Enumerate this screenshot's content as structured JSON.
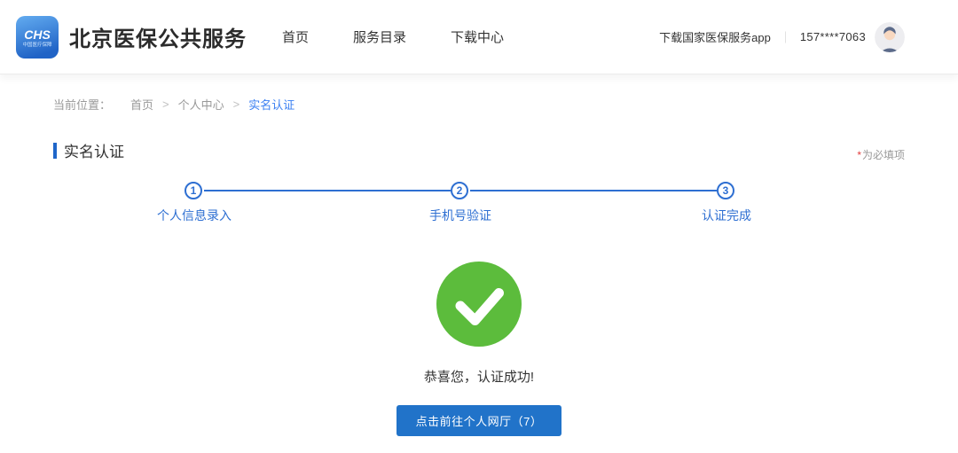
{
  "header": {
    "logo": {
      "abbr": "CHS",
      "subtext": "中国医疗保障"
    },
    "title": "北京医保公共服务",
    "nav": [
      {
        "label": "首页"
      },
      {
        "label": "服务目录"
      },
      {
        "label": "下载中心"
      }
    ],
    "download_app": "下载国家医保服务app",
    "divider": "｜",
    "phone": "157****7063"
  },
  "breadcrumb": {
    "prefix": "当前位置：",
    "items": [
      "首页",
      "个人中心",
      "实名认证"
    ],
    "separator": ">"
  },
  "page": {
    "title": "实名认证",
    "required_star": "*",
    "required_note": "为必填项"
  },
  "steps": [
    {
      "num": "1",
      "label": "个人信息录入"
    },
    {
      "num": "2",
      "label": "手机号验证"
    },
    {
      "num": "3",
      "label": "认证完成"
    }
  ],
  "result": {
    "message": "恭喜您，认证成功!",
    "button_label": "点击前往个人网厅（7）"
  },
  "colors": {
    "accent_blue": "#2e6fd2",
    "link_blue": "#3a7ff2",
    "button_blue": "#2173c9",
    "title_bar_blue": "#1f66c9",
    "success_green": "#5cbc3c",
    "required_red": "#e23c3c"
  }
}
